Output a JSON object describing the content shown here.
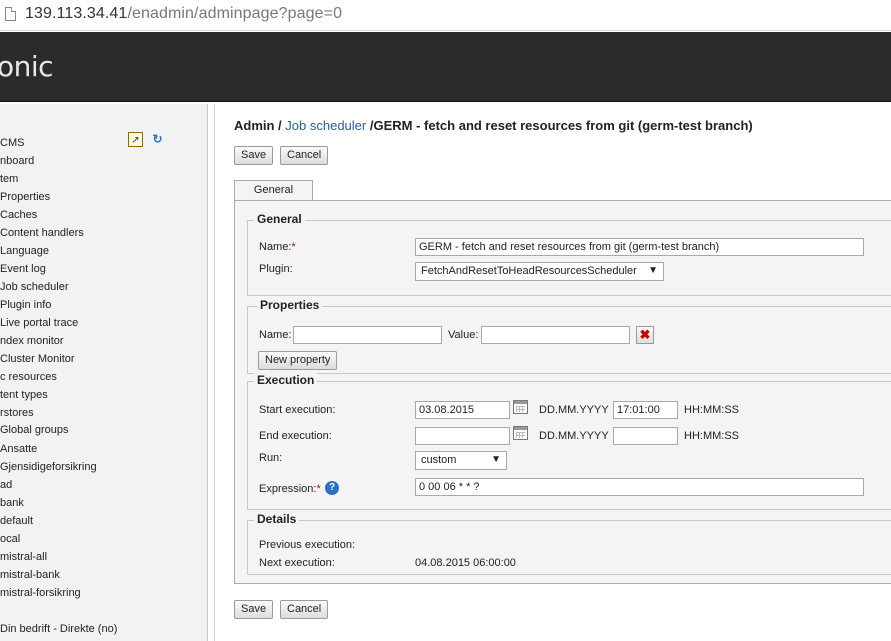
{
  "browser": {
    "url_host": "139.113.34.41",
    "url_path": "/enadmin/adminpage?page=0"
  },
  "header": {
    "logo_text": "onic"
  },
  "sidebar": {
    "items": [
      "CMS",
      "nboard",
      "tem",
      "Properties",
      "Caches",
      "Content handlers",
      "Language",
      "Event log",
      "Job scheduler",
      "Plugin info",
      "Live portal trace",
      "ndex monitor",
      "Cluster Monitor",
      "c resources",
      "tent types",
      "rstores",
      "Global groups",
      "Ansatte",
      "Gjensidigeforsikring",
      "ad",
      "bank",
      "default",
      "ocal",
      "mistral-all",
      "mistral-bank",
      "mistral-forsikring",
      "",
      "Din bedrift - Direkte (no)"
    ]
  },
  "breadcrumb": {
    "root": "Admin /",
    "link": "Job scheduler",
    "current": "/GERM - fetch and reset resources from git (germ-test branch)"
  },
  "toolbar": {
    "save_label": "Save",
    "cancel_label": "Cancel"
  },
  "tabs": {
    "general": "General"
  },
  "general": {
    "legend": "General",
    "name_label": "Name:",
    "name_req": "*",
    "name_value": "GERM - fetch and reset resources from git (germ-test branch)",
    "plugin_label": "Plugin:",
    "plugin_value": "FetchAndResetToHeadResourcesScheduler"
  },
  "properties": {
    "legend": "Properties",
    "name_label": "Name:",
    "value_label": "Value:",
    "name_value": "",
    "value_value": "",
    "new_property_label": "New property"
  },
  "execution": {
    "legend": "Execution",
    "start_label": "Start execution:",
    "start_date": "03.08.2015",
    "start_time": "17:01:00",
    "date_format": "DD.MM.YYYY",
    "time_format": "HH:MM:SS",
    "end_label": "End execution:",
    "end_date": "",
    "end_time": "",
    "run_label": "Run:",
    "run_value": "custom",
    "expression_label": "Expression:",
    "expression_req": "*",
    "expression_value": "0 00 06 * * ?"
  },
  "details": {
    "legend": "Details",
    "previous_label": "Previous execution:",
    "previous_value": "",
    "next_label": "Next execution:",
    "next_value": "04.08.2015 06:00:00"
  },
  "icons": {
    "export": "export-icon",
    "refresh": "refresh-icon",
    "calendar": "calendar-icon",
    "delete": "delete-icon",
    "help": "help-icon",
    "dropdown": "chevron-down-icon"
  },
  "colors": {
    "link": "#2a5ea8",
    "header_bg": "#2b2b2b",
    "required": "#c00"
  }
}
